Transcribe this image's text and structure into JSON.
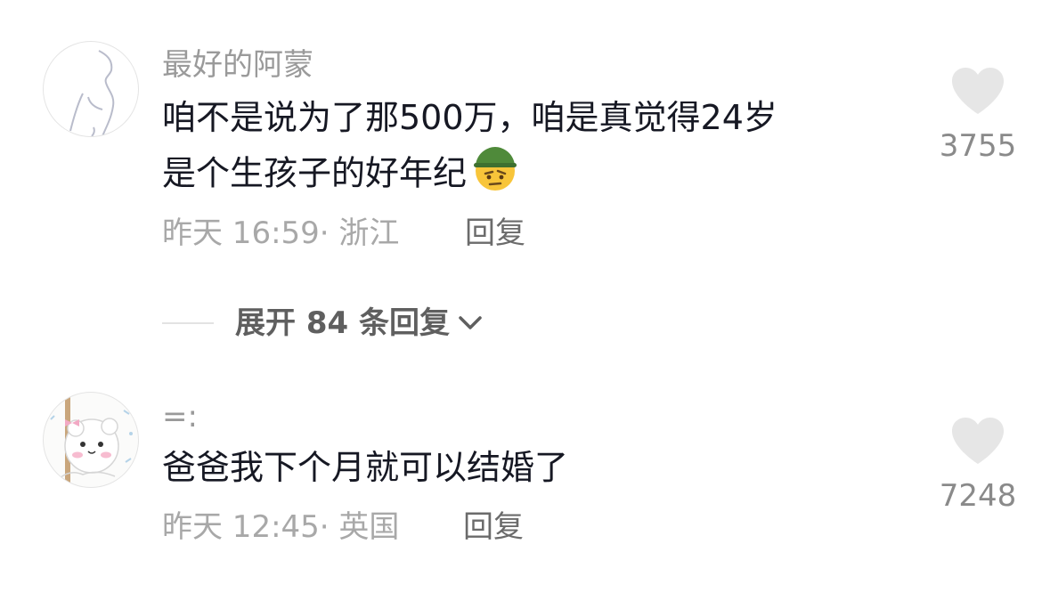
{
  "comments": [
    {
      "username": "最好的阿蒙",
      "text_line1": "咱不是说为了那500万，咱是真觉得24岁",
      "text_line2": "是个生孩子的好年纪",
      "emoji": "soldier-thinking-emoji",
      "time": "昨天 16:59",
      "separator": "·",
      "location": "浙江",
      "reply_label": "回复",
      "likes": "3755"
    },
    {
      "username": "=:",
      "text": "爸爸我下个月就可以结婚了",
      "time": "昨天 12:45",
      "separator": "·",
      "location": "英国",
      "reply_label": "回复",
      "likes": "7248"
    }
  ],
  "expand": {
    "label": "展开 84 条回复",
    "icon": "chevron-down-icon"
  },
  "colors": {
    "text": "#161823",
    "muted": "#a8a8a8",
    "heart": "#e6e6e6"
  }
}
